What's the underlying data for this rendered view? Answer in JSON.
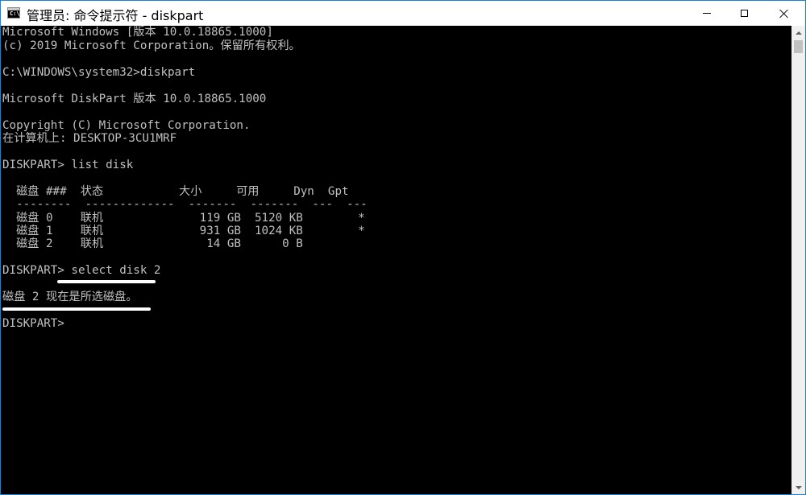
{
  "window": {
    "title": "管理员: 命令提示符 - diskpart",
    "icon": "cmd-icon",
    "icon_prompt": "C:\\_"
  },
  "console": {
    "lines": [
      "Microsoft Windows [版本 10.0.18865.1000]",
      "(c) 2019 Microsoft Corporation。保留所有权利。",
      "",
      "C:\\WINDOWS\\system32>diskpart",
      "",
      "Microsoft DiskPart 版本 10.0.18865.1000",
      "",
      "Copyright (C) Microsoft Corporation.",
      "在计算机上: DESKTOP-3CU1MRF",
      "",
      "DISKPART> list disk",
      "",
      "  磁盘 ###  状态           大小     可用     Dyn  Gpt",
      "  --------  -------------  -------  -------  ---  ---",
      "  磁盘 0    联机              119 GB  5120 KB        *",
      "  磁盘 1    联机              931 GB  1024 KB        *",
      "  磁盘 2    联机               14 GB      0 B",
      "",
      "DISKPART> select disk 2",
      "",
      "磁盘 2 现在是所选磁盘。",
      "",
      "DISKPART>"
    ]
  },
  "colors": {
    "console_bg": "#000000",
    "console_text": "#c0c0c0",
    "titlebar_bg": "#ffffff",
    "window_border": "#1883d7",
    "highlight_underline": "#ffffff"
  }
}
